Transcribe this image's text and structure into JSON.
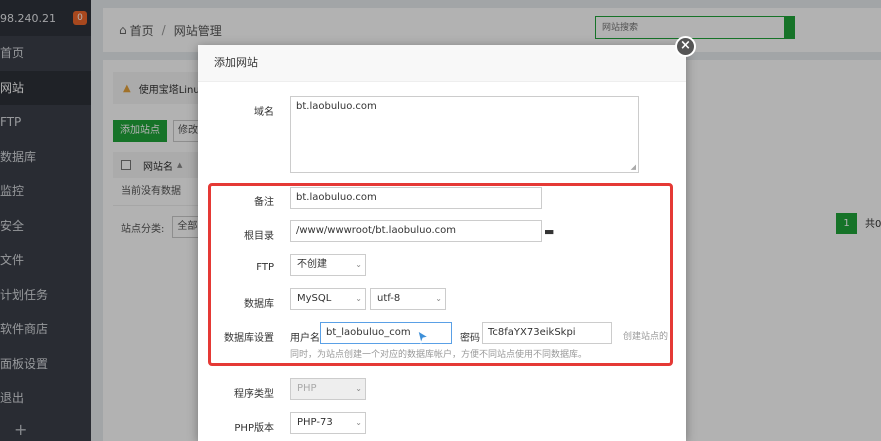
{
  "sidebar": {
    "ip": "98.240.21",
    "badge": "0",
    "items": [
      {
        "label": "首页"
      },
      {
        "label": "网站"
      },
      {
        "label": "FTP"
      },
      {
        "label": "数据库"
      },
      {
        "label": "监控"
      },
      {
        "label": "安全"
      },
      {
        "label": "文件"
      },
      {
        "label": "计划任务"
      },
      {
        "label": "软件商店"
      },
      {
        "label": "面板设置"
      },
      {
        "label": "退出"
      }
    ],
    "plus": "+"
  },
  "breadcrumb": {
    "home": "首页",
    "sep": "/",
    "current": "网站管理"
  },
  "search": {
    "placeholder": "网站搜索"
  },
  "panel": {
    "warning": "使用宝塔Linu",
    "add_site": "添加站点",
    "edit": "修改",
    "col_sitename": "网站名",
    "no_data": "当前没有数据",
    "category_label": "站点分类:",
    "category_value": "全部",
    "page_current": "1",
    "page_total": "共0条"
  },
  "modal": {
    "title": "添加网站",
    "domain_label": "域名",
    "domain_value": "bt.laobuluo.com",
    "remark_label": "备注",
    "remark_value": "bt.laobuluo.com",
    "root_label": "根目录",
    "root_value": "/www/wwwroot/bt.laobuluo.com",
    "ftp_label": "FTP",
    "ftp_value": "不创建",
    "db_label": "数据库",
    "db_value": "MySQL",
    "charset_value": "utf-8",
    "dbset_label": "数据库设置",
    "user_label": "用户名",
    "user_value": "bt_laobuluo_com",
    "pwd_label": "密码",
    "pwd_value": "Tc8faYX73eikSkpi",
    "create_hint": "创建站点的",
    "db_hint": "同时，为站点创建一个对应的数据库帐户，方便不同站点使用不同数据库。",
    "type_label": "程序类型",
    "type_value": "PHP",
    "php_label": "PHP版本",
    "php_value": "PHP-73"
  },
  "colors": {
    "accent": "#20a53a",
    "highlight": "#e53935",
    "sidebar": "#3b4049"
  }
}
